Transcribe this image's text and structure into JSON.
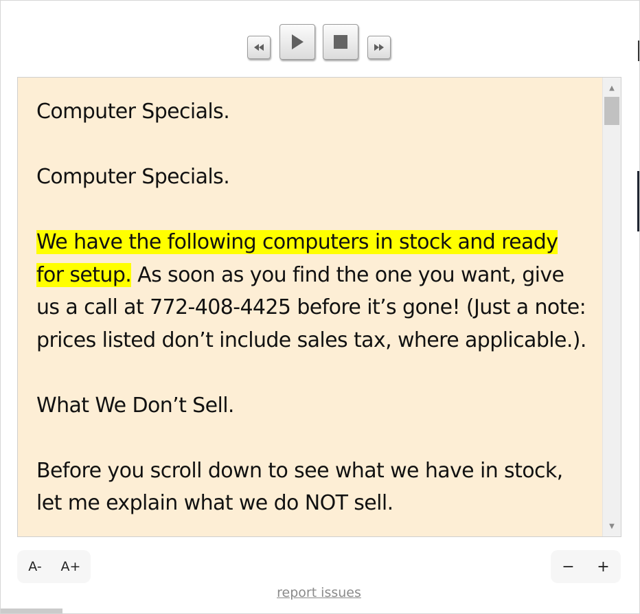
{
  "player": {
    "rewind_icon": "rewind-icon",
    "play_icon": "play-icon",
    "stop_icon": "stop-icon",
    "fast_forward_icon": "fast-forward-icon"
  },
  "reader": {
    "background_color": "#fdeed5",
    "highlight_color": "#ffff00",
    "paragraphs": {
      "p1": "Computer Specials.",
      "p2": "Computer Specials.",
      "p3_highlighted": "We have the following computers in stock and ready for setup.",
      "p3_rest": " As soon as you find the one you want, give us a call at 772-408-4425 before it’s gone! (Just a note: prices listed don’t include sales tax, where applicable.).",
      "p4": "What We Don’t Sell.",
      "p5": "Before you scroll down to see what we have in stock, let me explain what we do NOT sell."
    }
  },
  "controls": {
    "font_decrease": "A-",
    "font_increase": "A+",
    "zoom_out": "−",
    "zoom_in": "+"
  },
  "footer": {
    "report_issues": "report issues"
  }
}
